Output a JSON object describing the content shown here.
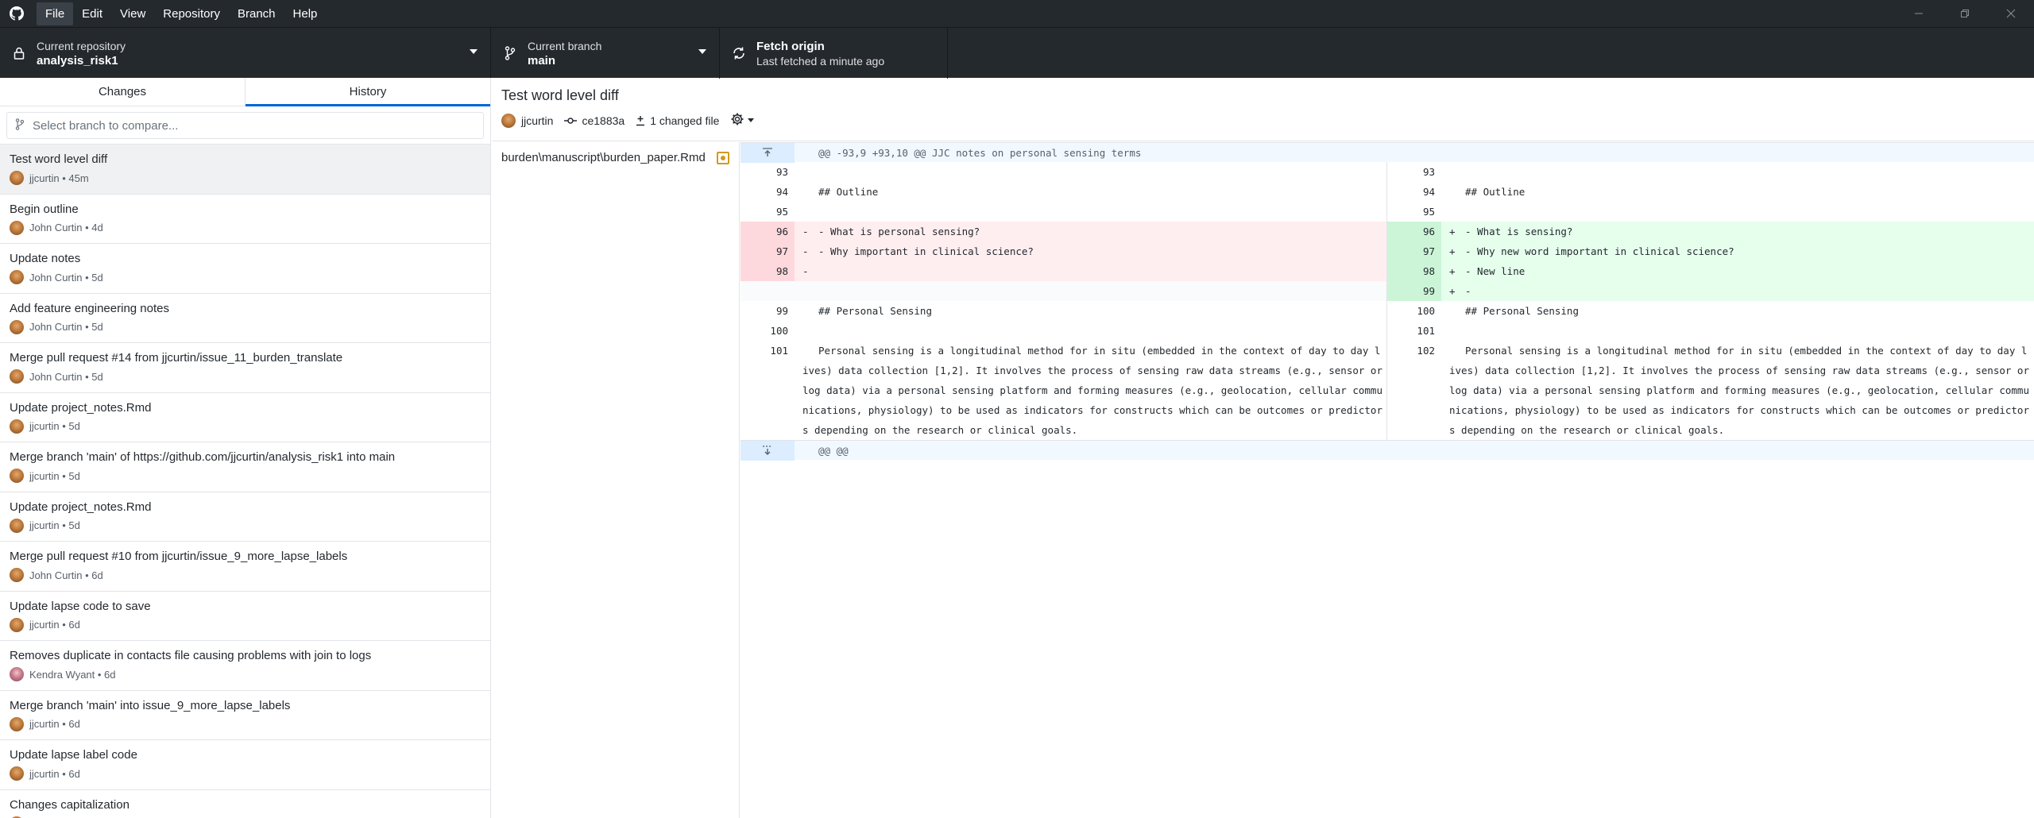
{
  "menu": [
    "File",
    "Edit",
    "View",
    "Repository",
    "Branch",
    "Help"
  ],
  "toolbar": {
    "repo_label": "Current repository",
    "repo_value": "analysis_risk1",
    "branch_label": "Current branch",
    "branch_value": "main",
    "fetch_title": "Fetch origin",
    "fetch_sub": "Last fetched a minute ago"
  },
  "tabs": {
    "changes": "Changes",
    "history": "History"
  },
  "compare": {
    "placeholder": "Select branch to compare..."
  },
  "commits": [
    {
      "title": "Test word level diff",
      "author": "jjcurtin",
      "age": "45m",
      "avatar": "jj"
    },
    {
      "title": "Begin outline",
      "author": "John Curtin",
      "age": "4d",
      "avatar": "jj"
    },
    {
      "title": "Update notes",
      "author": "John Curtin",
      "age": "5d",
      "avatar": "jj"
    },
    {
      "title": "Add feature engineering notes",
      "author": "John Curtin",
      "age": "5d",
      "avatar": "jj"
    },
    {
      "title": "Merge pull request #14 from jjcurtin/issue_11_burden_translate",
      "author": "John Curtin",
      "age": "5d",
      "avatar": "jj"
    },
    {
      "title": "Update project_notes.Rmd",
      "author": "jjcurtin",
      "age": "5d",
      "avatar": "jj"
    },
    {
      "title": "Merge branch 'main' of https://github.com/jjcurtin/analysis_risk1 into main",
      "author": "jjcurtin",
      "age": "5d",
      "avatar": "jj"
    },
    {
      "title": "Update project_notes.Rmd",
      "author": "jjcurtin",
      "age": "5d",
      "avatar": "jj"
    },
    {
      "title": "Merge pull request #10 from jjcurtin/issue_9_more_lapse_labels",
      "author": "John Curtin",
      "age": "6d",
      "avatar": "jj"
    },
    {
      "title": "Update lapse code to save",
      "author": "jjcurtin",
      "age": "6d",
      "avatar": "jj"
    },
    {
      "title": "Removes duplicate in contacts file causing problems with join to logs",
      "author": "Kendra Wyant",
      "age": "6d",
      "avatar": "kw"
    },
    {
      "title": "Merge branch 'main' into issue_9_more_lapse_labels",
      "author": "jjcurtin",
      "age": "6d",
      "avatar": "jj"
    },
    {
      "title": "Update lapse label code",
      "author": "jjcurtin",
      "age": "6d",
      "avatar": "jj"
    },
    {
      "title": "Changes capitalization",
      "author": "",
      "age": "",
      "avatar": "jj"
    }
  ],
  "commit": {
    "title": "Test word level diff",
    "author": "jjcurtin",
    "sha": "ce1883a",
    "changed": "1 changed file"
  },
  "file": {
    "path": "burden\\manuscript\\burden_paper.Rmd"
  },
  "diff": {
    "hunk_header": "@@ -93,9 +93,10 @@ JJC notes on personal sensing terms",
    "hunk_footer": "@@ @@",
    "rows": [
      {
        "l": "93",
        "lt": "",
        "lk": "ctx",
        "r": "93",
        "rt": "",
        "rk": "ctx"
      },
      {
        "l": "94",
        "lt": "## Outline",
        "lk": "ctx",
        "r": "94",
        "rt": "## Outline",
        "rk": "ctx"
      },
      {
        "l": "95",
        "lt": "",
        "lk": "ctx",
        "r": "95",
        "rt": "",
        "rk": "ctx"
      },
      {
        "l": "96",
        "lt": "- What is personal sensing?",
        "lk": "del",
        "r": "96",
        "rt": "- What is sensing?",
        "rk": "add"
      },
      {
        "l": "97",
        "lt": "- Why important in clinical science?",
        "lk": "del",
        "r": "97",
        "rt": "- Why new word important in clinical science?",
        "rk": "add"
      },
      {
        "l": "98",
        "lt": "",
        "lk": "del",
        "r": "98",
        "rt": "- New line",
        "rk": "add"
      },
      {
        "l": "",
        "lt": "",
        "lk": "empty",
        "r": "99",
        "rt": "-",
        "rk": "add"
      },
      {
        "l": "99",
        "lt": "## Personal Sensing",
        "lk": "ctx",
        "r": "100",
        "rt": "## Personal Sensing",
        "rk": "ctx"
      },
      {
        "l": "100",
        "lt": "",
        "lk": "ctx",
        "r": "101",
        "rt": "",
        "rk": "ctx"
      }
    ],
    "para_left_ln": "101",
    "para_right_ln": "102",
    "para_text": "Personal sensing is a longitudinal method for in situ (embedded in the context of day to day lives) data collection [1,2]. It involves the process of sensing raw data streams (e.g., sensor or log data) via a personal sensing platform and forming measures (e.g., geolocation, cellular communications, physiology) to be used as indicators for constructs which can be outcomes or predictors depending on the research or clinical goals."
  },
  "colors": {
    "titlebar": "#24292e",
    "accent": "#0366d6",
    "del_bg": "#ffeef0",
    "add_bg": "#e6ffed",
    "modified": "#d29922"
  }
}
